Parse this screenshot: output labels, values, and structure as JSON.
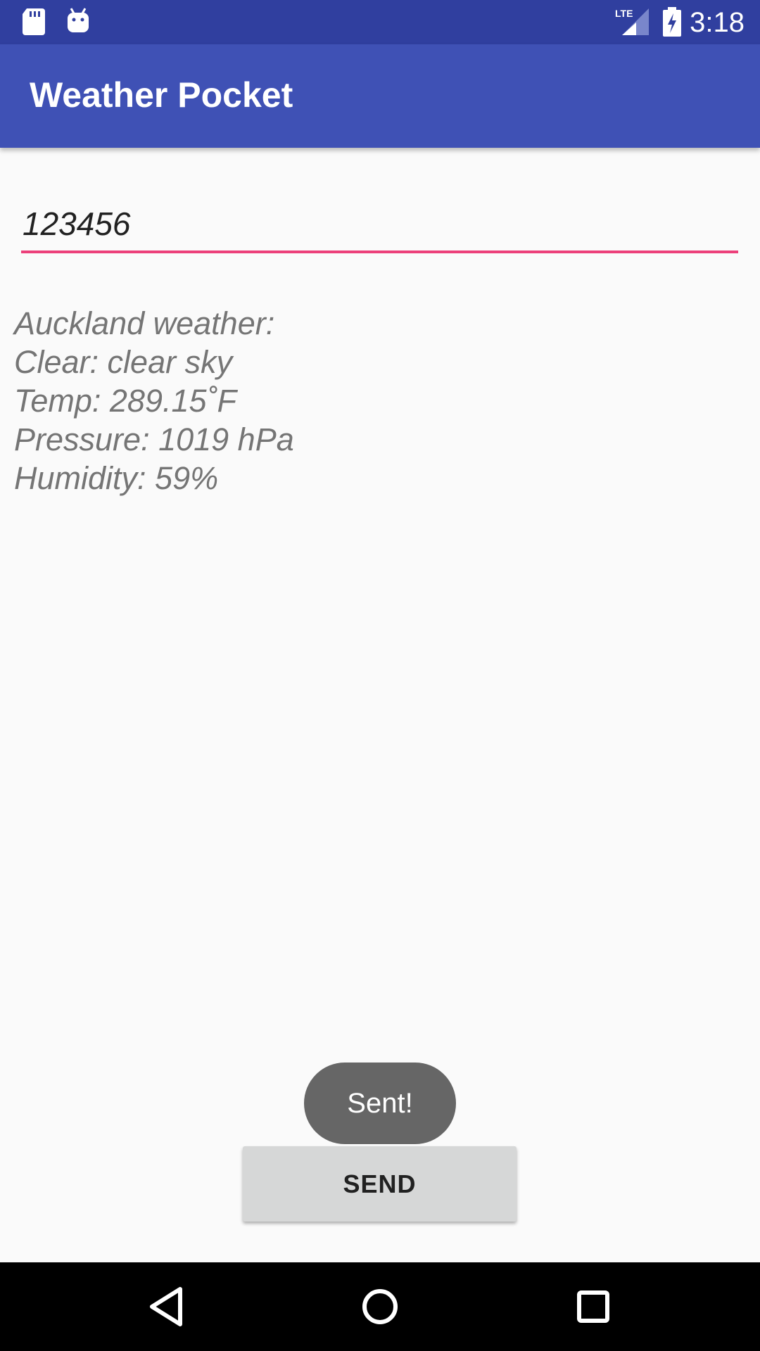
{
  "status_bar": {
    "time": "3:18",
    "icons": [
      "sd-card-icon",
      "android-icon",
      "lte-signal-icon",
      "battery-charging-icon"
    ]
  },
  "app_bar": {
    "title": "Weather Pocket",
    "color": "#3f51b5",
    "status_color": "#303f9f"
  },
  "zip_input": {
    "value": "123456",
    "underline_color": "#ec407a"
  },
  "weather": {
    "lines": [
      "Auckland weather:",
      "Clear: clear sky",
      "Temp: 289.15˚F",
      "Pressure: 1019 hPa",
      "Humidity: 59%"
    ]
  },
  "toast": {
    "text": "Sent!"
  },
  "send_button": {
    "label": "SEND"
  },
  "nav_bar": {
    "icons": [
      "back-icon",
      "home-icon",
      "recents-icon"
    ]
  }
}
